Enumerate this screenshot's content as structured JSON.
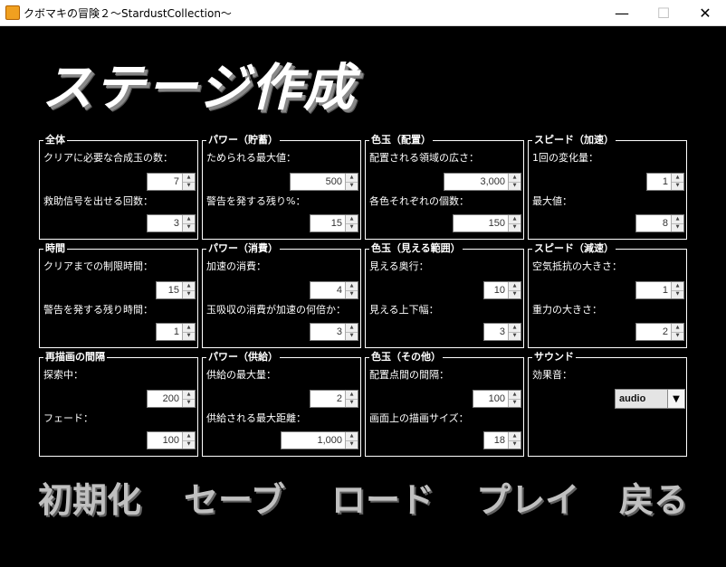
{
  "window": {
    "title": "クボマキの冒険２～StardustCollection～",
    "minimize_glyph": "—",
    "maximize_glyph": "☐",
    "close_glyph": "✕"
  },
  "heading": "ステージ作成",
  "panels": {
    "overall": {
      "title": "全体",
      "fields": [
        {
          "label": "クリアに必要な合成玉の数：",
          "value": "7"
        },
        {
          "label": "救助信号を出せる回数：",
          "value": "3"
        }
      ]
    },
    "power_storage": {
      "title": "パワー（貯蓄）",
      "fields": [
        {
          "label": "ためられる最大値：",
          "value": "500"
        },
        {
          "label": "警告を発する残り%：",
          "value": "15"
        }
      ]
    },
    "orb_placement": {
      "title": "色玉（配置）",
      "fields": [
        {
          "label": "配置される領域の広さ：",
          "value": "3,000"
        },
        {
          "label": "各色それぞれの個数：",
          "value": "150"
        }
      ]
    },
    "speed_accel": {
      "title": "スピード（加速）",
      "fields": [
        {
          "label": "1回の変化量：",
          "value": "1"
        },
        {
          "label": "最大値：",
          "value": "8"
        }
      ]
    },
    "time": {
      "title": "時間",
      "fields": [
        {
          "label": "クリアまでの制限時間：",
          "value": "15"
        },
        {
          "label": "警告を発する残り時間：",
          "value": "1"
        }
      ]
    },
    "power_consumption": {
      "title": "パワー（消費）",
      "fields": [
        {
          "label": "加速の消費：",
          "value": "4"
        },
        {
          "label": "玉吸収の消費が加速の何倍か：",
          "value": "3"
        }
      ]
    },
    "orb_visible_range": {
      "title": "色玉（見える範囲）",
      "fields": [
        {
          "label": "見える奥行：",
          "value": "10"
        },
        {
          "label": "見える上下幅：",
          "value": "3"
        }
      ]
    },
    "speed_decel": {
      "title": "スピード（減速）",
      "fields": [
        {
          "label": "空気抵抗の大きさ：",
          "value": "1"
        },
        {
          "label": "重力の大きさ：",
          "value": "2"
        }
      ]
    },
    "redraw_interval": {
      "title": "再描画の間隔",
      "fields": [
        {
          "label": "探索中：",
          "value": "200"
        },
        {
          "label": "フェード：",
          "value": "100"
        }
      ]
    },
    "power_supply": {
      "title": "パワー（供給）",
      "fields": [
        {
          "label": "供給の最大量：",
          "value": "2"
        },
        {
          "label": "供給される最大距離：",
          "value": "1,000"
        }
      ]
    },
    "orb_other": {
      "title": "色玉（その他）",
      "fields": [
        {
          "label": "配置点間の間隔：",
          "value": "100"
        },
        {
          "label": "画面上の描画サイズ：",
          "value": "18"
        }
      ]
    },
    "sound": {
      "title": "サウンド",
      "effect_label": "効果音：",
      "effect_value": "audio"
    }
  },
  "actions": {
    "init": "初期化",
    "save": "セーブ",
    "load": "ロード",
    "play": "プレイ",
    "back": "戻る"
  },
  "spinner_glyphs": {
    "up": "▲",
    "down": "▼"
  },
  "combo_glyph": "▼"
}
